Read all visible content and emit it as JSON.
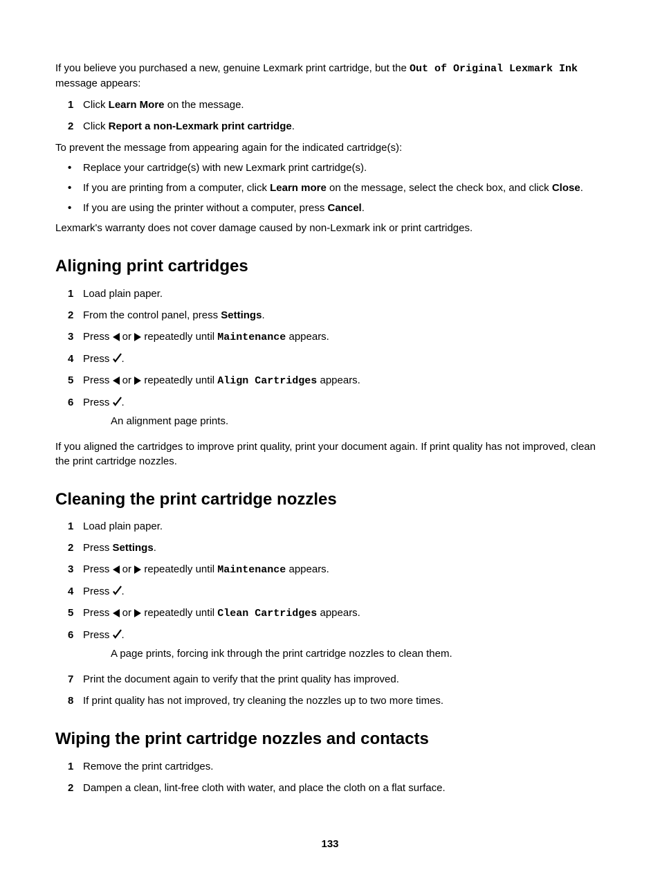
{
  "intro": {
    "p1a": "If you believe you purchased a new, genuine Lexmark print cartridge, but the ",
    "p1_mono": "Out of Original Lexmark Ink",
    "p1b": " message appears:",
    "step1a": "Click ",
    "step1b": "Learn More",
    "step1c": " on the message.",
    "step2a": "Click ",
    "step2b": "Report a non-Lexmark print cartridge",
    "step2c": ".",
    "p2": "To prevent the message from appearing again for the indicated cartridge(s):",
    "bul1": "Replace your cartridge(s) with new Lexmark print cartridge(s).",
    "bul2a": "If you are printing from a computer, click ",
    "bul2b": "Learn more",
    "bul2c": " on the message, select the check box, and click ",
    "bul2d": "Close",
    "bul2e": ".",
    "bul3a": "If you are using the printer without a computer, press ",
    "bul3b": "Cancel",
    "bul3c": ".",
    "p3": "Lexmark's warranty does not cover damage caused by non-Lexmark ink or print cartridges."
  },
  "align": {
    "heading": "Aligning print cartridges",
    "s1": "Load plain paper.",
    "s2a": "From the control panel, press ",
    "s2b": "Settings",
    "s2c": ".",
    "s3a": "Press ",
    "s3b": " or ",
    "s3c": " repeatedly until ",
    "s3d": "Maintenance",
    "s3e": " appears.",
    "s4a": "Press ",
    "s4b": ".",
    "s5a": "Press ",
    "s5b": " or ",
    "s5c": " repeatedly until ",
    "s5d": "Align Cartridges",
    "s5e": " appears.",
    "s6a": "Press ",
    "s6b": ".",
    "s6sub": "An alignment page prints.",
    "p1": "If you aligned the cartridges to improve print quality, print your document again. If print quality has not improved, clean the print cartridge nozzles."
  },
  "clean": {
    "heading": "Cleaning the print cartridge nozzles",
    "s1": "Load plain paper.",
    "s2a": "Press ",
    "s2b": "Settings",
    "s2c": ".",
    "s3a": "Press ",
    "s3b": " or ",
    "s3c": " repeatedly until ",
    "s3d": "Maintenance",
    "s3e": " appears.",
    "s4a": "Press ",
    "s4b": ".",
    "s5a": "Press ",
    "s5b": " or ",
    "s5c": " repeatedly until ",
    "s5d": "Clean Cartridges",
    "s5e": " appears.",
    "s6a": "Press ",
    "s6b": ".",
    "s6sub": "A page prints, forcing ink through the print cartridge nozzles to clean them.",
    "s7": "Print the document again to verify that the print quality has improved.",
    "s8": "If print quality has not improved, try cleaning the nozzles up to two more times."
  },
  "wipe": {
    "heading": "Wiping the print cartridge nozzles and contacts",
    "s1": "Remove the print cartridges.",
    "s2": "Dampen a clean, lint-free cloth with water, and place the cloth on a flat surface."
  },
  "pageNumber": "133"
}
